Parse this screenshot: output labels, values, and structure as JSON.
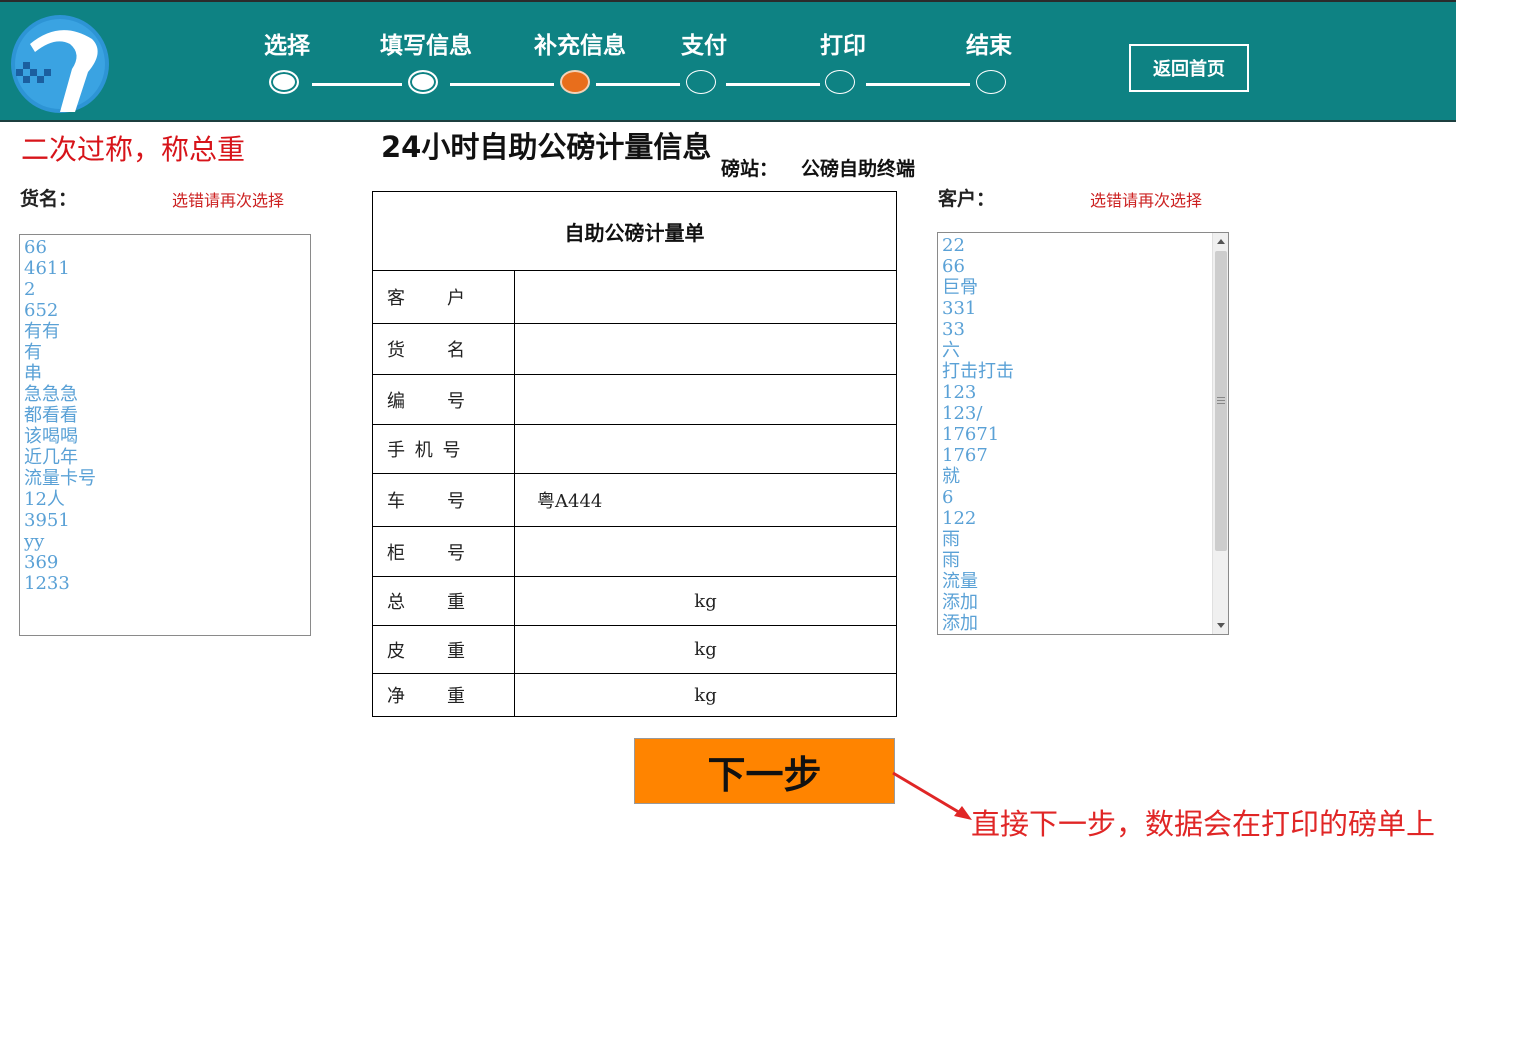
{
  "header": {
    "steps": [
      {
        "label": "选择",
        "state": "done"
      },
      {
        "label": "填写信息",
        "state": "done"
      },
      {
        "label": "补充信息",
        "state": "current"
      },
      {
        "label": "支付",
        "state": "todo"
      },
      {
        "label": "打印",
        "state": "todo"
      },
      {
        "label": "结束",
        "state": "todo"
      }
    ],
    "home_button": "返回首页"
  },
  "left": {
    "section_title": "二次过称，称总重",
    "goods_label": "货名：",
    "goods_hint": "选错请再次选择",
    "goods_items": [
      "66",
      "4611",
      "2",
      "652",
      "有有",
      "有",
      "串",
      "急急急",
      "都看看",
      "该喝喝",
      "近几年",
      "流量卡号",
      "12人",
      "3951",
      "yy",
      "369",
      "1233"
    ]
  },
  "center": {
    "title": "24小时自助公磅计量信息",
    "station_label": "磅站：",
    "station_value": "公磅自助终端",
    "ticket": {
      "header": "自助公磅计量单",
      "rows": [
        {
          "label": "客　　户",
          "value": ""
        },
        {
          "label": "货　　名",
          "value": ""
        },
        {
          "label": "编　　号",
          "value": ""
        },
        {
          "label": "手 机 号",
          "value": ""
        },
        {
          "label": "车　　号",
          "value": "粤A444"
        },
        {
          "label": "柜　　号",
          "value": ""
        }
      ],
      "weight_rows": [
        {
          "label": "总　　重",
          "unit": "kg"
        },
        {
          "label": "皮　　重",
          "unit": "kg"
        },
        {
          "label": "净　　重",
          "unit": "kg"
        }
      ]
    },
    "next_button": "下一步"
  },
  "right": {
    "customer_label": "客户：",
    "customer_hint": "选错请再次选择",
    "customer_items": [
      "22",
      "66",
      "巨骨",
      "331",
      "33",
      "六",
      "打击打击",
      "123",
      "123/",
      "17671",
      "1767",
      "就",
      "6",
      "122",
      "雨",
      "雨",
      "流量",
      "添加",
      "添加"
    ]
  },
  "annotation": "直接下一步，数据会在打印的磅单上",
  "colors": {
    "header_bg": "#0e8283",
    "current_step": "#e86e1c",
    "next_button": "#ff8400",
    "annotation": "#e02626",
    "list_text": "#5aa1d6"
  }
}
